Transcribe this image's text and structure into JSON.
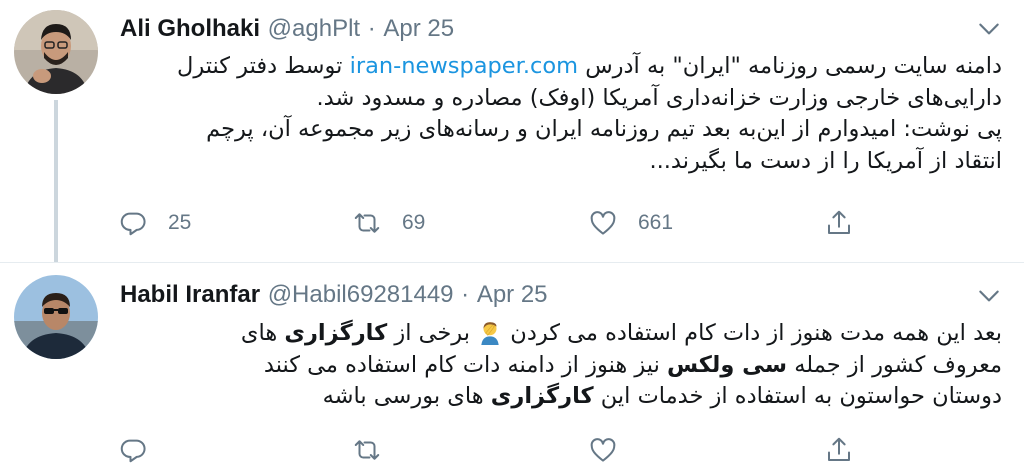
{
  "tweets": [
    {
      "author": {
        "name": "Ali Gholhaki",
        "handle": "@aghPlt"
      },
      "separator": "·",
      "date": "Apr 25",
      "body": {
        "line1_pre": "دامنه سایت رسمی روزنامه \"ایران\" به آدرس ",
        "line1_link": "iran-newspaper.com",
        "line1_post": " توسط دفتر کنترل",
        "line2": "دارایی‌های خارجی وزارت خزانه‌داری آمریکا (اوفک) مصادره و مسدود شد.",
        "line3": "پی نوشت: امیدوارم از این‌به بعد تیم روزنامه ایران و رسانه‌های زیر مجموعه آن، پرچم",
        "line4": "انتقاد از آمریکا را از دست ما بگیرند..."
      },
      "stats": {
        "replies": "25",
        "retweets": "69",
        "likes": "661"
      }
    },
    {
      "author": {
        "name": "Habil Iranfar",
        "handle": "@Habil69281449"
      },
      "separator": "·",
      "date": "Apr 25",
      "body": {
        "l1_a": "بعد این همه مدت هنوز از دات کام استفاده می کردن",
        "l1_b": " برخی از ",
        "l1_bold": "کارگزاری",
        "l1_c": " های",
        "l2_a": "معروف کشور از جمله ",
        "l2_bold": "سی ولکس",
        "l2_b": " نیز هنوز از دامنه دات کام استفاده می کنند",
        "l3_a": "دوستان حواستون به استفاده از خدمات این ",
        "l3_bold": "کارگزاری",
        "l3_b": " های بورسی باشه"
      },
      "stats": {
        "replies": "",
        "retweets": "",
        "likes": ""
      }
    }
  ],
  "icons": {
    "reply": "reply-icon",
    "retweet": "retweet-icon",
    "like": "heart-icon",
    "share": "share-icon",
    "menu": "chevron-down-icon",
    "emoji": "facepalm-emoji"
  },
  "colors": {
    "link": "#1b95e0",
    "muted": "#657786",
    "icon": "#657786",
    "thread": "#ccd6dd"
  }
}
